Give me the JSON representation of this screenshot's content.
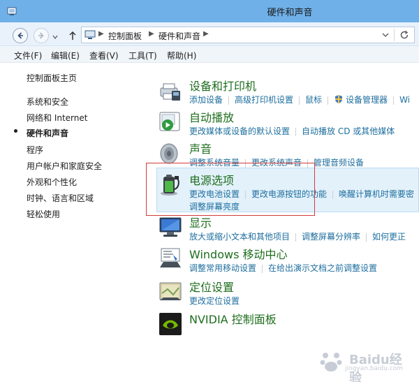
{
  "window": {
    "title": "硬件和声音"
  },
  "address": {
    "crumbs": [
      "控制面板",
      "硬件和声音"
    ]
  },
  "menu": [
    "文件(F)",
    "编辑(E)",
    "查看(V)",
    "工具(T)",
    "帮助(H)"
  ],
  "sidebar": {
    "items": [
      {
        "label": "控制面板主页"
      },
      {
        "label": "系统和安全"
      },
      {
        "label": "网络和 Internet"
      },
      {
        "label": "硬件和声音",
        "active": true
      },
      {
        "label": "程序"
      },
      {
        "label": "用户帐户和家庭安全"
      },
      {
        "label": "外观和个性化"
      },
      {
        "label": "时钟、语言和区域"
      },
      {
        "label": "轻松使用"
      }
    ]
  },
  "categories": [
    {
      "title": "设备和打印机",
      "icon": "printer-icon",
      "links": [
        "添加设备",
        "高级打印机设置",
        "鼠标",
        "设备管理器",
        "Wi"
      ]
    },
    {
      "title": "自动播放",
      "icon": "autoplay-icon",
      "links": [
        "更改媒体或设备的默认设置",
        "自动播放 CD 或其他媒体"
      ]
    },
    {
      "title": "声音",
      "icon": "speaker-icon",
      "links": [
        "调整系统音量",
        "更改系统声音",
        "管理音频设备"
      ]
    },
    {
      "title": "电源选项",
      "icon": "battery-icon",
      "links": [
        "更改电池设置",
        "更改电源按钮的功能",
        "唤醒计算机时需要密"
      ],
      "links2": [
        "调整屏幕亮度"
      ]
    },
    {
      "title": "显示",
      "icon": "display-icon",
      "links": [
        "放大或缩小文本和其他项目",
        "调整屏幕分辨率",
        "如何更正"
      ]
    },
    {
      "title": "Windows 移动中心",
      "icon": "mobility-icon",
      "links": [
        "调整常用移动设置",
        "在给出演示文档之前调整设置"
      ]
    },
    {
      "title": "定位设置",
      "icon": "location-icon",
      "links": [
        "更改定位设置"
      ]
    },
    {
      "title": "NVIDIA 控制面板",
      "icon": "nvidia-icon",
      "links": []
    }
  ],
  "watermark": {
    "text": "Baidu经验",
    "url": "jingyan.baidu.com"
  }
}
